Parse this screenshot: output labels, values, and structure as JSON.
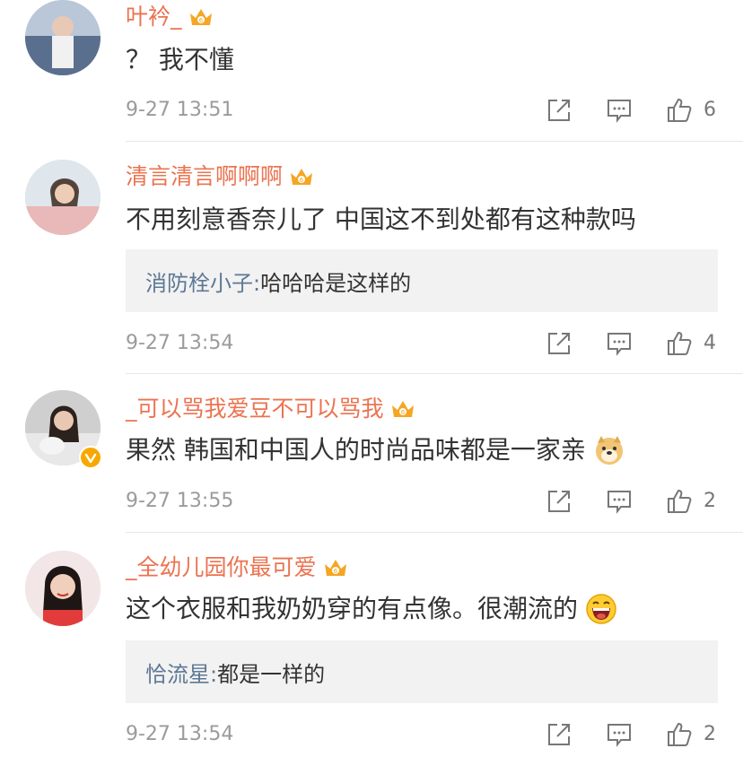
{
  "comments": [
    {
      "username": "叶衿_",
      "text": "？ 我不懂",
      "time": "9-27 13:51",
      "likes": "6"
    },
    {
      "username": "清言清言啊啊啊",
      "text": "不用刻意香奈儿了 中国这不到处都有这种款吗",
      "reply_name": "消防栓小子:",
      "reply_text": " 哈哈哈是这样的",
      "time": "9-27 13:54",
      "likes": "4"
    },
    {
      "username": "_可以骂我爱豆不可以骂我",
      "text": "果然 韩国和中国人的时尚品味都是一家亲",
      "time": "9-27 13:55",
      "likes": "2"
    },
    {
      "username": "_全幼儿园你最可爱",
      "text": "这个衣服和我奶奶穿的有点像。很潮流的",
      "reply_name": "恰流星:",
      "reply_text": " 都是一样的",
      "time": "9-27 13:54",
      "likes": "2"
    }
  ],
  "icons": {
    "crown": "crown-badge-icon",
    "verified": "verified-v-icon",
    "share": "share-icon",
    "comment": "comment-icon",
    "like": "thumbs-up-icon",
    "emoji_doge": "doge-emoji-icon",
    "emoji_laugh": "laugh-emoji-icon"
  },
  "colors": {
    "username": "#eb7350",
    "reply_name": "#5d7895",
    "text": "#333333",
    "meta": "#9b9b9b",
    "reply_bg": "#f2f2f2",
    "badge": "#f7a800"
  }
}
